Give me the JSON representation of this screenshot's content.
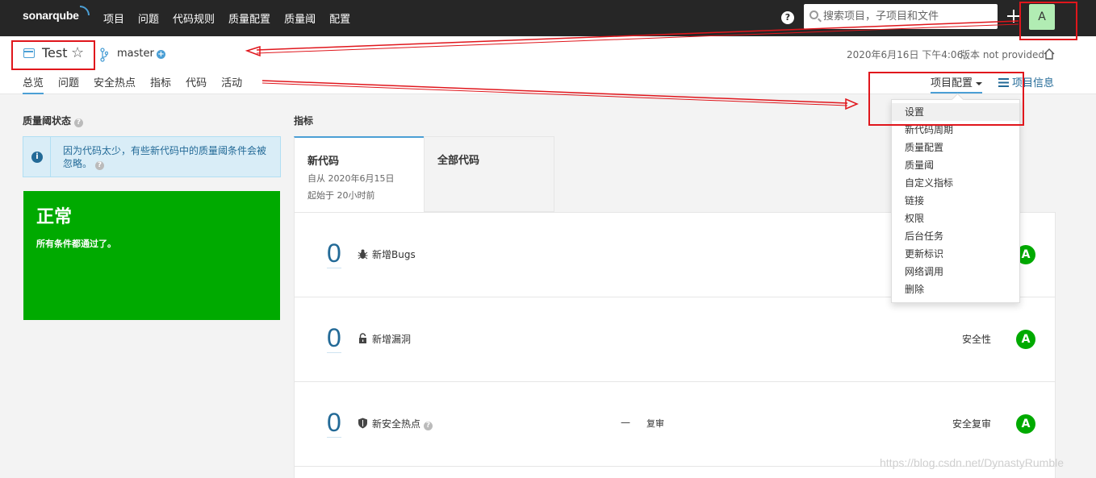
{
  "topnav": {
    "logo": "sonarqube",
    "items": [
      "项目",
      "问题",
      "代码规则",
      "质量配置",
      "质量阈",
      "配置"
    ],
    "help": "?",
    "search_placeholder": "搜索项目，子项目和文件",
    "avatar_letter": "A"
  },
  "project": {
    "name": "Test",
    "branch": "master",
    "analysis_date": "2020年6月16日 下午4:06",
    "version": "版本 not provided",
    "tabs": [
      "总览",
      "问题",
      "安全热点",
      "指标",
      "代码",
      "活动"
    ],
    "admin_menu": "项目配置",
    "info_link": "项目信息"
  },
  "quality_gate": {
    "title": "质量阈状态",
    "info_text": "因为代码太少，有些新代码中的质量阈条件会被忽略。",
    "status": "正常",
    "status_desc": "所有条件都通过了。",
    "status_color": "#00aa00"
  },
  "metrics": {
    "title": "指标",
    "tab_new": {
      "label": "新代码",
      "since": "自从 2020年6月15日",
      "started": "起始于 20小时前"
    },
    "tab_all": {
      "label": "全部代码"
    },
    "rows": [
      {
        "value": "0",
        "label": "新增Bugs",
        "icon": "bug-icon",
        "category": "",
        "grade": "A"
      },
      {
        "value": "0",
        "label": "新增漏洞",
        "icon": "lock-icon",
        "category": "安全性",
        "grade": "A"
      },
      {
        "value": "0",
        "label": "新安全热点",
        "icon": "shield-icon",
        "category": "安全复审",
        "grade": "A",
        "review_value": "—",
        "review_label": "复审"
      }
    ]
  },
  "dropdown": {
    "items": [
      "设置",
      "新代码周期",
      "质量配置",
      "质量阈",
      "自定义指标",
      "链接",
      "权限",
      "后台任务",
      "更新标识",
      "网络调用",
      "删除"
    ]
  },
  "watermark": "https://blog.csdn.net/DynastyRumble",
  "colors": {
    "accent": "#4b9fd5",
    "link": "#236a97",
    "annotation": "#e0161c",
    "ok": "#00aa00"
  }
}
